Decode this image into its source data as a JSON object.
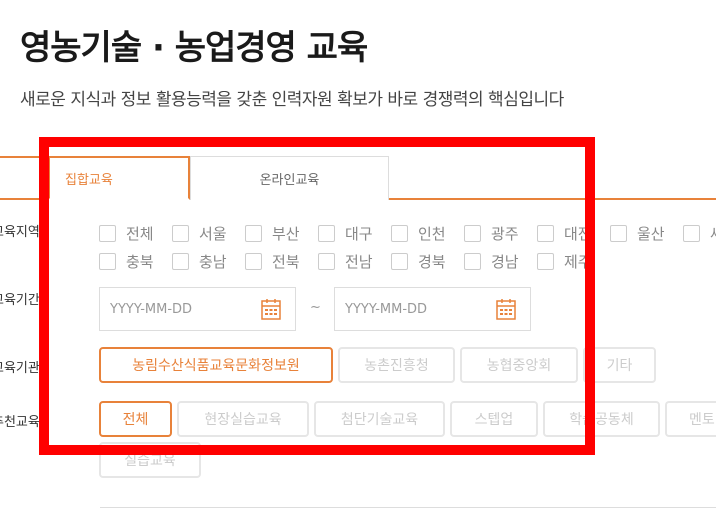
{
  "header": {
    "title": "영농기술 · 농업경영 교육",
    "subtitle": "새로운 지식과 정보 활용능력을 갖춘 인력자원 확보가 바로 경쟁력의 핵심입니다"
  },
  "tabs": [
    {
      "label": "집합교육",
      "active": true
    },
    {
      "label": "온라인교육",
      "active": false
    }
  ],
  "filters": {
    "region": {
      "label": "교육지역",
      "options": [
        "전체",
        "서울",
        "부산",
        "대구",
        "인천",
        "광주",
        "대전",
        "울산",
        "세종",
        "충북",
        "충남",
        "전북",
        "전남",
        "경북",
        "경남",
        "제주"
      ]
    },
    "period": {
      "label": "교육기간",
      "start_placeholder": "YYYY-MM-DD",
      "end_placeholder": "YYYY-MM-DD",
      "separator": "~"
    },
    "institution": {
      "label": "교육기관",
      "options": [
        "농림수산식품교육문화정보원",
        "농촌진흥청",
        "농협중앙회",
        "기타"
      ],
      "selected": "농림수산식품교육문화정보원"
    },
    "recommended": {
      "label": "추천교육",
      "options": [
        "전체",
        "현장실습교육",
        "첨단기술교육",
        "스텝업",
        "학습공동체",
        "멘토링",
        "실습교육"
      ],
      "selected": "전체"
    }
  },
  "colors": {
    "accent": "#e8823a",
    "highlight": "#ff0000"
  }
}
